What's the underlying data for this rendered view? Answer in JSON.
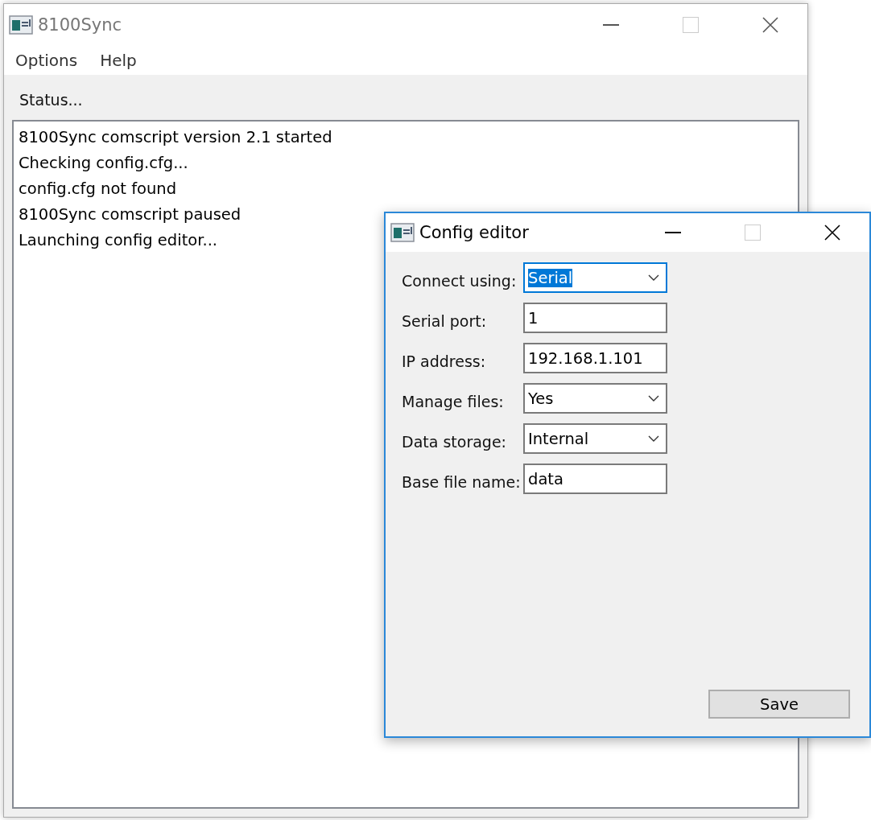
{
  "main_window": {
    "title": "8100Sync",
    "menu": [
      "Options",
      "Help"
    ],
    "status_label": "Status...",
    "log": [
      "8100Sync comscript version 2.1 started",
      "Checking config.cfg...",
      "config.cfg not found",
      "8100Sync comscript paused",
      "Launching config editor..."
    ]
  },
  "dialog": {
    "title": "Config editor",
    "fields": [
      {
        "label": "Connect using:",
        "kind": "select",
        "value": "Serial",
        "focused": true
      },
      {
        "label": "Serial port:",
        "kind": "text",
        "value": "1",
        "focused": false
      },
      {
        "label": "IP address:",
        "kind": "text",
        "value": "192.168.1.101",
        "focused": false
      },
      {
        "label": "Manage files:",
        "kind": "select",
        "value": "Yes",
        "focused": false
      },
      {
        "label": "Data storage:",
        "kind": "select",
        "value": "Internal",
        "focused": false
      },
      {
        "label": "Base file name:",
        "kind": "text",
        "value": "data",
        "focused": false
      }
    ],
    "save_button": "Save"
  }
}
